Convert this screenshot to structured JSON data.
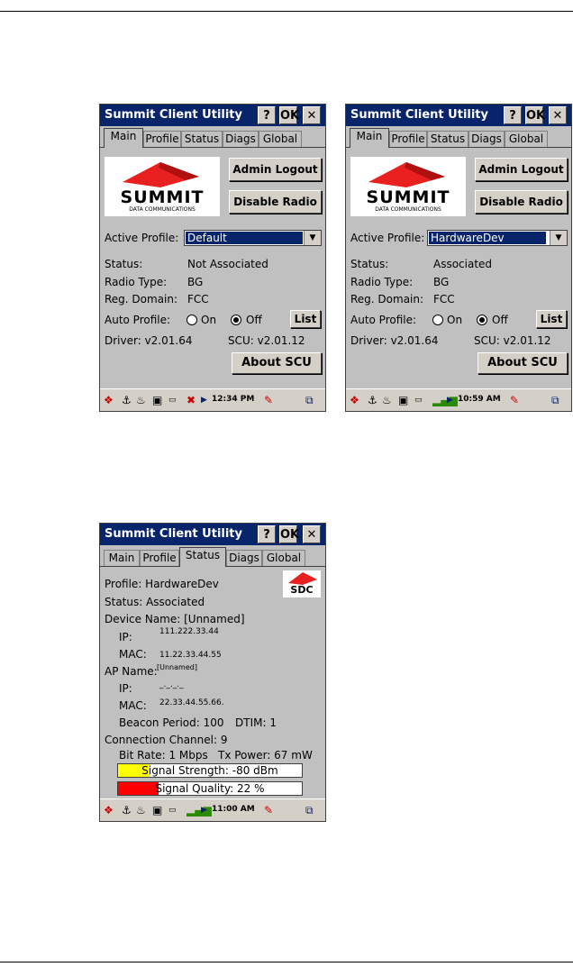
{
  "colors": {
    "titlebar": "#08246b",
    "signal_strength": "#ffff00",
    "signal_quality": "#ff0000",
    "logo_red": "#e8201f"
  },
  "window": {
    "title": "Summit Client Utility",
    "help_label": "?",
    "ok_label": "OK",
    "close_label": "✕"
  },
  "tabs": [
    "Main",
    "Profile",
    "Status",
    "Diags",
    "Global"
  ],
  "main_screens": [
    {
      "admin_logout": "Admin Logout",
      "disable_radio": "Disable Radio",
      "logo_word": "SUMMIT",
      "logo_sub": "DATA COMMUNICATIONS",
      "active_profile_label": "Active Profile:",
      "active_profile_value": "Default",
      "status_label": "Status:",
      "status_value": "Not Associated",
      "radio_type_label": "Radio Type:",
      "radio_type_value": "BG",
      "reg_domain_label": "Reg. Domain:",
      "reg_domain_value": "FCC",
      "auto_profile_label": "Auto Profile:",
      "on_label": "On",
      "off_label": "Off",
      "auto_profile_selected": "Off",
      "list_label": "List",
      "driver": "Driver:  v2.01.64",
      "scu": "SCU: v2.01.12",
      "about": "About SCU",
      "clock": "12:34 PM"
    },
    {
      "admin_logout": "Admin Logout",
      "disable_radio": "Disable Radio",
      "logo_word": "SUMMIT",
      "logo_sub": "DATA COMMUNICATIONS",
      "active_profile_label": "Active Profile:",
      "active_profile_value": "HardwareDev",
      "status_label": "Status:",
      "status_value": "Associated",
      "radio_type_label": "Radio Type:",
      "radio_type_value": "BG",
      "reg_domain_label": "Reg. Domain:",
      "reg_domain_value": "FCC",
      "auto_profile_label": "Auto Profile:",
      "on_label": "On",
      "off_label": "Off",
      "auto_profile_selected": "Off",
      "list_label": "List",
      "driver": "Driver:  v2.01.64",
      "scu": "SCU: v2.01.12",
      "about": "About SCU",
      "clock": "10:59 AM"
    }
  ],
  "status_screen": {
    "profile": "Profile: HardwareDev",
    "status": "Status: Associated",
    "device_name": "Device Name: [Unnamed]",
    "ip_label": "IP:",
    "ip_value": "111.222.33.44",
    "mac_label": "MAC:",
    "mac_value": "11.22.33.44.55",
    "ap_name_label": "AP Name:",
    "ap_name_value": "[Unnamed]",
    "ap_ip_label": "IP:",
    "ap_ip_value": "_._._._",
    "ap_mac_label": "MAC:",
    "ap_mac_value": "22.33.44.55.66.",
    "beacon": "Beacon Period: 100",
    "dtim": "DTIM: 1",
    "channel": "Connection Channel:  9",
    "bit_rate": "Bit Rate: 1 Mbps",
    "tx_power": "Tx Power:  67 mW",
    "signal_strength": "Signal Strength: -80 dBm",
    "signal_strength_fill": 0.17,
    "signal_quality": "Signal Quality: 22 %",
    "signal_quality_fill": 0.22,
    "sdc_logo": "SDC",
    "clock": "11:00 AM"
  }
}
